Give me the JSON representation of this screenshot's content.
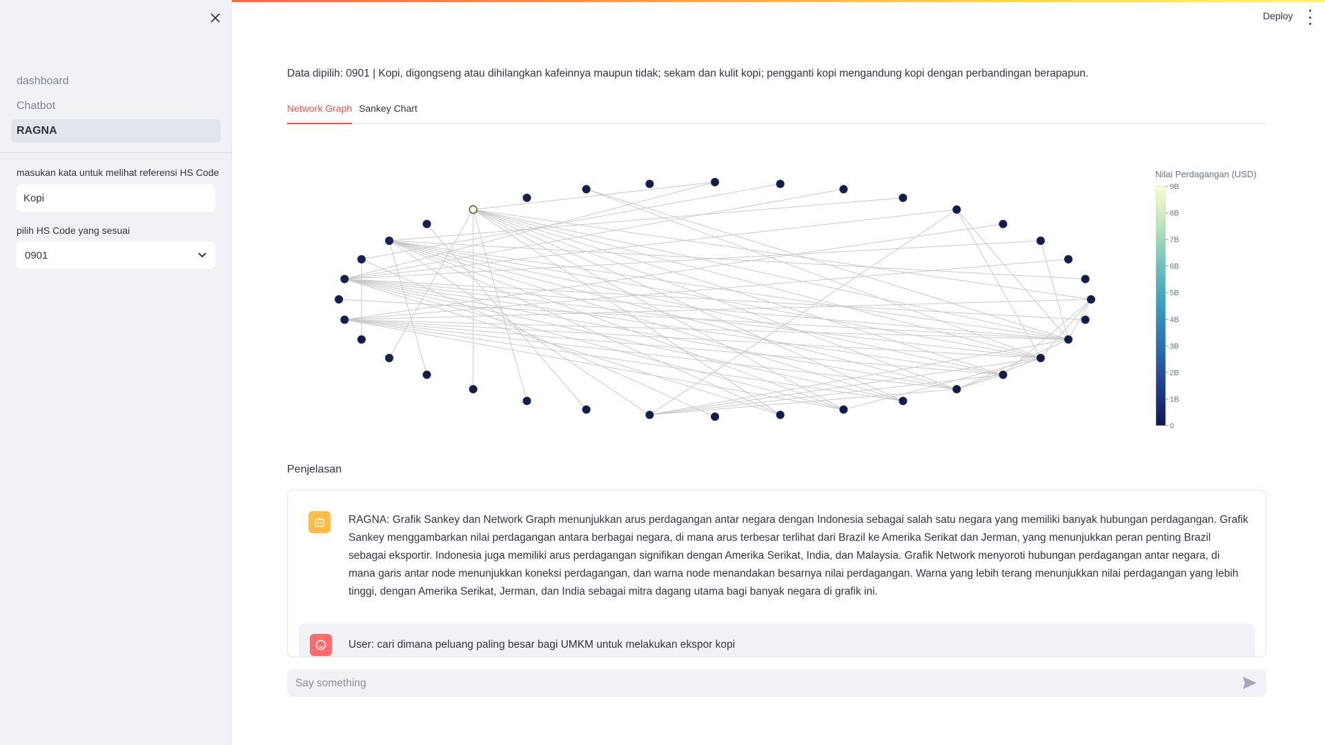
{
  "sidebar": {
    "nav_items": [
      {
        "label": "dashboard",
        "active": false
      },
      {
        "label": "Chatbot",
        "active": false
      },
      {
        "label": "RAGNA",
        "active": true
      }
    ],
    "search": {
      "label": "masukan kata untuk melihat referensi HS Code",
      "value": "Kopi"
    },
    "hs_select": {
      "label": "pilih HS Code yang sesuai",
      "value": "0901"
    }
  },
  "header": {
    "deploy_label": "Deploy"
  },
  "main": {
    "data_line": "Data dipilih: 0901 | Kopi, digongseng atau dihilangkan kafeinnya maupun tidak; sekam dan kulit kopi; pengganti kopi mengandung kopi dengan perbandingan berapapun.",
    "tabs": [
      {
        "label": "Network Graph",
        "active": true
      },
      {
        "label": "Sankey Chart",
        "active": false
      }
    ],
    "section_label": "Penjelasan",
    "messages": [
      {
        "role": "assistant",
        "avatar_icon": "robot-icon",
        "text": "RAGNA: Grafik Sankey dan Network Graph menunjukkan arus perdagangan antar negara dengan Indonesia sebagai salah satu negara yang memiliki banyak hubungan perdagangan. Grafik Sankey menggambarkan nilai perdagangan antara berbagai negara, di mana arus terbesar terlihat dari Brazil ke Amerika Serikat dan Jerman, yang menunjukkan peran penting Brazil sebagai eksportir. Indonesia juga memiliki arus perdagangan signifikan dengan Amerika Serikat, India, dan Malaysia. Grafik Network menyoroti hubungan perdagangan antar negara, di mana garis antar node menunjukkan koneksi perdagangan, dan warna node menandakan besarnya nilai perdagangan. Warna yang lebih terang menunjukkan nilai perdagangan yang lebih tinggi, dengan Amerika Serikat, Jerman, dan India sebagai mitra dagang utama bagi banyak negara di grafik ini."
      },
      {
        "role": "user",
        "avatar_icon": "user-face-icon",
        "text": "User: cari dimana peluang paling besar bagi UMKM untuk melakukan ekspor kopi"
      }
    ],
    "chat_input": {
      "placeholder": "Say something"
    }
  },
  "colors": {
    "accent": "#ff4b4b",
    "assistant_avatar": "#ffbd45",
    "user_avatar": "#ff6b6b",
    "edge": "#c9c9c9",
    "node_outline": "#2f2f2f"
  },
  "chart_data": {
    "type": "network",
    "colorbar": {
      "title": "Nilai Perdagangan (USD)",
      "ticks": [
        "0",
        "1B",
        "2B",
        "3B",
        "4B",
        "5B",
        "6B",
        "7B",
        "8B",
        "9B"
      ],
      "range": [
        0,
        9000000000
      ],
      "colorscale": [
        "#0d1a54",
        "#1f3f8f",
        "#2a6fb0",
        "#3a9cbf",
        "#6ec2b9",
        "#b7e3b5",
        "#fbfdd0"
      ]
    },
    "node_count": 36,
    "node_values": [
      0.05,
      0.05,
      0.05,
      0.05,
      0.05,
      0.05,
      0.05,
      0.05,
      0.05,
      0.05,
      0.05,
      0.05,
      0.05,
      0.05,
      0.05,
      0.05,
      0.05,
      0.05,
      0.05,
      0.3,
      0.05,
      0.1,
      0.05,
      0.05,
      0.25,
      0.05,
      0.3,
      0.05,
      0.2,
      0.25,
      0.35,
      0.2,
      9.0,
      0.25,
      0.05,
      0.05
    ],
    "edges": [
      [
        11,
        4
      ],
      [
        11,
        6
      ],
      [
        11,
        9
      ],
      [
        11,
        14
      ],
      [
        11,
        19
      ],
      [
        11,
        26
      ],
      [
        11,
        28
      ],
      [
        11,
        30
      ],
      [
        11,
        32
      ],
      [
        11,
        34
      ],
      [
        12,
        4
      ],
      [
        12,
        9
      ],
      [
        12,
        14
      ],
      [
        12,
        16
      ],
      [
        12,
        19
      ],
      [
        12,
        26
      ],
      [
        12,
        28
      ],
      [
        12,
        30
      ],
      [
        12,
        32
      ],
      [
        12,
        34
      ],
      [
        13,
        9
      ],
      [
        13,
        14
      ],
      [
        13,
        19
      ],
      [
        13,
        26
      ],
      [
        13,
        28
      ],
      [
        13,
        30
      ],
      [
        13,
        32
      ],
      [
        14,
        19
      ],
      [
        14,
        26
      ],
      [
        14,
        28
      ],
      [
        14,
        30
      ],
      [
        14,
        32
      ],
      [
        15,
        26
      ],
      [
        15,
        28
      ],
      [
        15,
        30
      ],
      [
        15,
        32
      ],
      [
        16,
        26
      ],
      [
        16,
        28
      ],
      [
        16,
        30
      ],
      [
        16,
        32
      ],
      [
        17,
        28
      ],
      [
        17,
        30
      ],
      [
        17,
        32
      ],
      [
        18,
        29
      ],
      [
        19,
        30
      ],
      [
        20,
        31
      ],
      [
        21,
        32
      ],
      [
        22,
        32
      ],
      [
        23,
        30
      ],
      [
        24,
        32
      ],
      [
        25,
        29
      ],
      [
        4,
        19
      ],
      [
        5,
        26
      ],
      [
        3,
        30
      ],
      [
        7,
        26
      ],
      [
        8,
        30
      ],
      [
        1,
        29
      ],
      [
        2,
        28
      ],
      [
        6,
        28
      ],
      [
        10,
        28
      ],
      [
        0,
        28
      ],
      [
        0,
        32
      ],
      [
        4,
        28
      ],
      [
        9,
        32
      ],
      [
        9,
        26
      ],
      [
        11,
        27
      ]
    ]
  }
}
